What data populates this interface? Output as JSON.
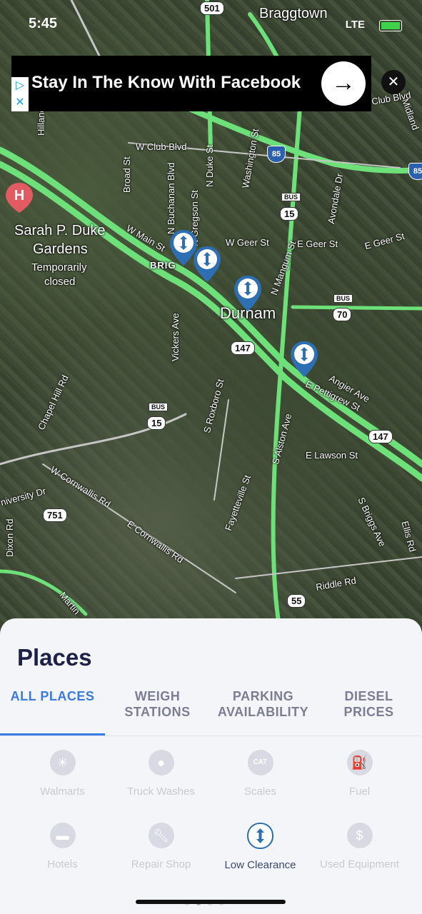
{
  "status": {
    "time": "5:45",
    "network": "LTE"
  },
  "ad": {
    "text": "Stay In The Know With Facebook",
    "info_icon": "adchoices-icon",
    "close_icon": "close-icon"
  },
  "map": {
    "labels": {
      "braggtown": "Braggtown",
      "sarah_duke": "Sarah P. Duke",
      "gardens": "Gardens",
      "temporarily": "Temporarily",
      "closed": "closed",
      "durham": "Durham",
      "w_club": "W Club Blvd",
      "broad": "Broad St",
      "buchanan": "N Buchanan Blvd",
      "gregson": "N Gregson St",
      "duke": "N Duke St",
      "washington": "Washington St",
      "avondale": "Avondale Dr",
      "w_main": "W Main St",
      "w_geer": "W Geer St",
      "e_geer": "E Geer St",
      "e_geer2": "E Geer St",
      "mangum": "N Mangum St",
      "vickers": "Vickers Ave",
      "chapel_hill": "Chapel Hill Rd",
      "roxboro": "S Roxboro St",
      "alston": "S Alston Ave",
      "angier": "Angier Ave",
      "pettigrew": "E Pettigrew St",
      "lawson": "E Lawson St",
      "w_cornwallis": "W Cornwallis Rd",
      "e_cornwallis": "E Cornwallis Rd",
      "fayetteville": "Fayetteville St",
      "university": "niversity Dr",
      "dixon": "Dixon Rd",
      "briggs": "S Briggs Ave",
      "riddle": "Riddle Rd",
      "martin": "Martin",
      "hillandale": "Hillandale Rd",
      "ellis": "Ellis Rd",
      "midland": "Midland",
      "club": "Club Blvd",
      "brig": "BRIG"
    },
    "shields": {
      "r501": "501",
      "r147a": "147",
      "r147b": "147",
      "r751": "751",
      "r55": "55",
      "bus15a": "15",
      "bus15b": "15",
      "bus70": "70",
      "bus": "BUS",
      "i85a": "85",
      "i85b": "85"
    },
    "pin_icon": "low-clearance-icon",
    "hospital": "H"
  },
  "panel": {
    "title": "Places",
    "tabs": [
      {
        "label": "ALL PLACES",
        "active": true
      },
      {
        "label": "WEIGH STATIONS",
        "active": false
      },
      {
        "label": "PARKING AVAILABILITY",
        "active": false
      },
      {
        "label": "DIESEL PRICES",
        "active": false
      }
    ],
    "categories": [
      {
        "label": "Walmarts",
        "icon": "walmart-spark-icon",
        "selected": false
      },
      {
        "label": "Truck Washes",
        "icon": "water-drop-icon",
        "selected": false
      },
      {
        "label": "Scales",
        "icon": "cat-scale-icon",
        "selected": false
      },
      {
        "label": "Fuel",
        "icon": "fuel-pump-icon",
        "selected": false
      },
      {
        "label": "Hotels",
        "icon": "bed-icon",
        "selected": false
      },
      {
        "label": "Repair Shop",
        "icon": "wrench-icon",
        "selected": false
      },
      {
        "label": "Low Clearance",
        "icon": "low-clearance-icon",
        "selected": true
      },
      {
        "label": "Used Equipment",
        "icon": "truck-dollar-icon",
        "selected": false
      }
    ],
    "colors": {
      "accent": "#3a7be0",
      "title": "#1d2147",
      "selected_icon": "#2d6fb2"
    }
  }
}
